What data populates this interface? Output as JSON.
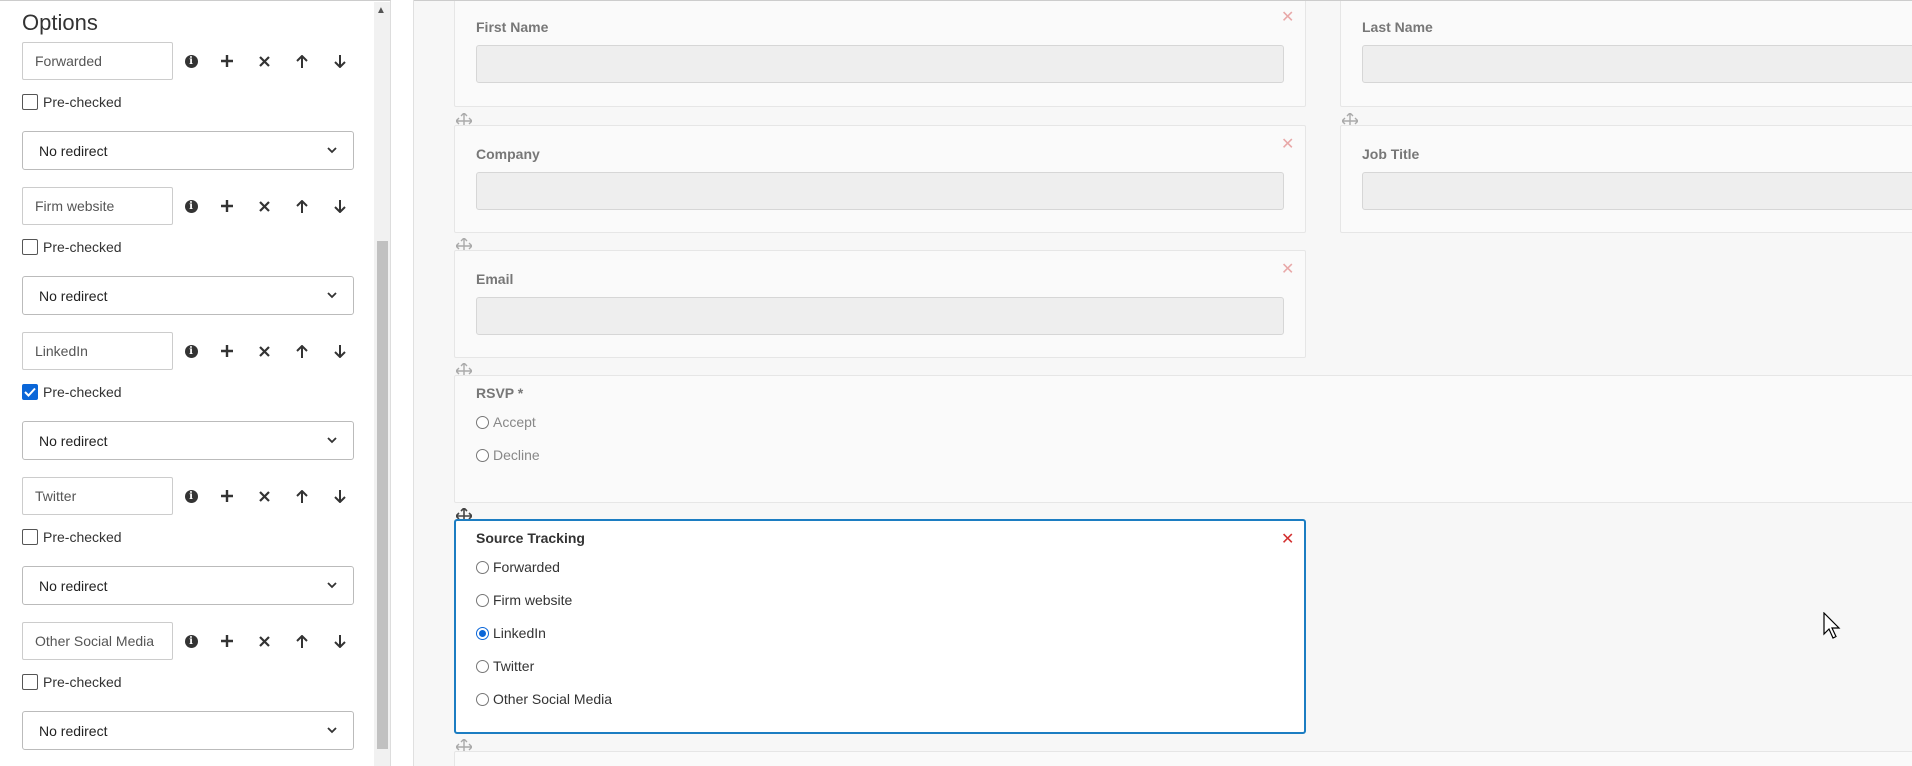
{
  "options_panel": {
    "title": "Options",
    "items": [
      {
        "value": "Forwarded",
        "prechecked": false,
        "prechecked_label": "Pre-checked",
        "redirect": "No redirect"
      },
      {
        "value": "Firm website",
        "prechecked": false,
        "prechecked_label": "Pre-checked",
        "redirect": "No redirect"
      },
      {
        "value": "LinkedIn",
        "prechecked": true,
        "prechecked_label": "Pre-checked",
        "redirect": "No redirect"
      },
      {
        "value": "Twitter",
        "prechecked": false,
        "prechecked_label": "Pre-checked",
        "redirect": "No redirect"
      },
      {
        "value": "Other Social Media",
        "prechecked": false,
        "prechecked_label": "Pre-checked",
        "redirect": "No redirect"
      }
    ],
    "icons": [
      "info-icon",
      "plus-icon",
      "times-icon",
      "arrow-up-icon",
      "arrow-down-icon"
    ]
  },
  "form": {
    "first_name": {
      "label": "First Name"
    },
    "last_name": {
      "label": "Last Name"
    },
    "company": {
      "label": "Company"
    },
    "job_title": {
      "label": "Job Title"
    },
    "email": {
      "label": "Email"
    },
    "rsvp": {
      "label": "RSVP *",
      "options": [
        "Accept",
        "Decline"
      ]
    },
    "source_tracking": {
      "label": "Source Tracking",
      "options": [
        "Forwarded",
        "Firm website",
        "LinkedIn",
        "Twitter",
        "Other Social Media"
      ],
      "selected": "LinkedIn"
    }
  },
  "colors": {
    "accent": "#1c7dc2",
    "checkbox_checked": "#0a66d8",
    "close_active": "#d32f2f",
    "close_inactive": "#e8a8a8"
  }
}
